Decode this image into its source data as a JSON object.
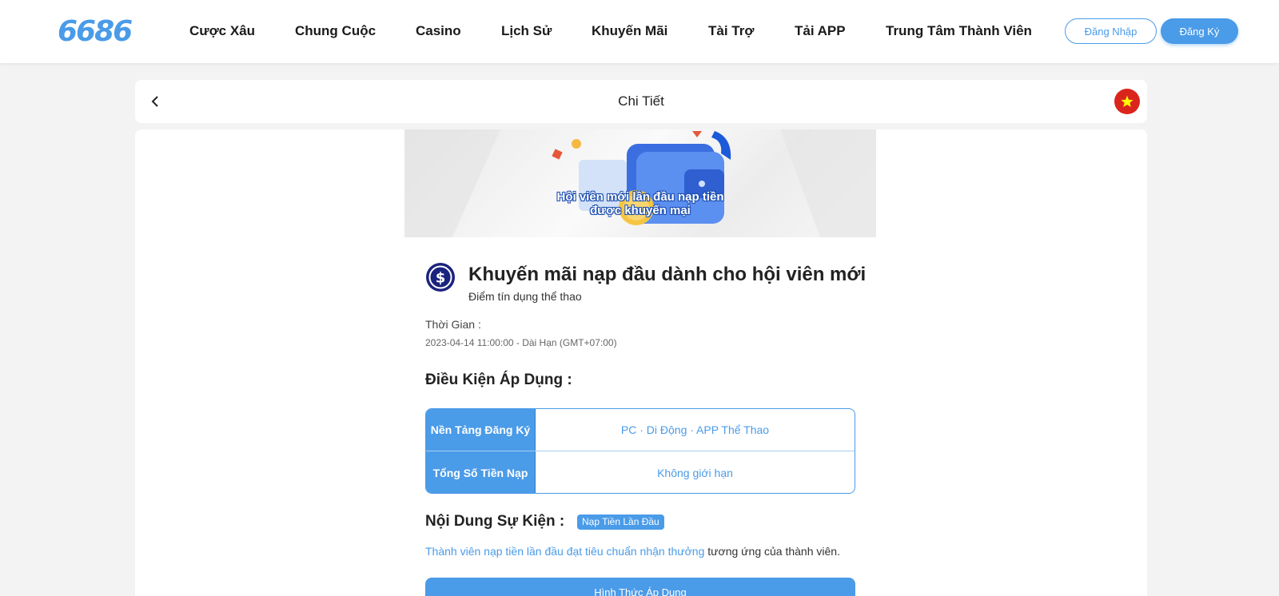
{
  "header": {
    "logo": "6686",
    "nav": [
      {
        "label": "Cược Xâu"
      },
      {
        "label": "Chung Cuộc"
      },
      {
        "label": "Casino"
      },
      {
        "label": "Lịch Sử"
      },
      {
        "label": "Khuyến Mãi"
      },
      {
        "label": "Tài Trợ"
      },
      {
        "label": "Tải APP"
      },
      {
        "label": "Trung Tâm Thành Viên"
      }
    ],
    "login_label": "Đăng Nhập",
    "register_label": "Đăng Ký"
  },
  "titlebar": {
    "title": "Chi Tiết",
    "back_icon": "chevron-left-icon",
    "flag_icon": "vietnam-flag-icon"
  },
  "banner": {
    "line1": "Hội viên mới lần đầu nạp tiền",
    "line2": "được khuyến mại"
  },
  "promo": {
    "title": "Khuyến mãi nạp đầu dành cho hội viên mới",
    "subtitle": "Điểm tín dụng thể thao",
    "time_label": "Thời Gian :",
    "time_value": "2023-04-14 11:00:00 - Dài Hạn (GMT+07:00)"
  },
  "conditions": {
    "heading": "Điều Kiện Áp Dụng :",
    "rows": [
      {
        "key": "Nền Tảng Đăng Ký",
        "value": "PC · Di Động · APP Thể Thao"
      },
      {
        "key": "Tổng Số Tiền Nạp",
        "value": "Không giới hạn"
      }
    ]
  },
  "event": {
    "heading": "Nội Dung Sự Kiện :",
    "badge": "Nạp Tiền Lần Đầu",
    "text_highlight": "Thành viên nạp tiền lần đầu đạt tiêu chuẩn nhận thưởng",
    "text_rest": " tương ứng của thành viên.",
    "apply_label": "Hình Thức Áp Dụng"
  },
  "colors": {
    "accent": "#4a9be8",
    "flag_red": "#da251d",
    "flag_star": "#ffff00"
  }
}
